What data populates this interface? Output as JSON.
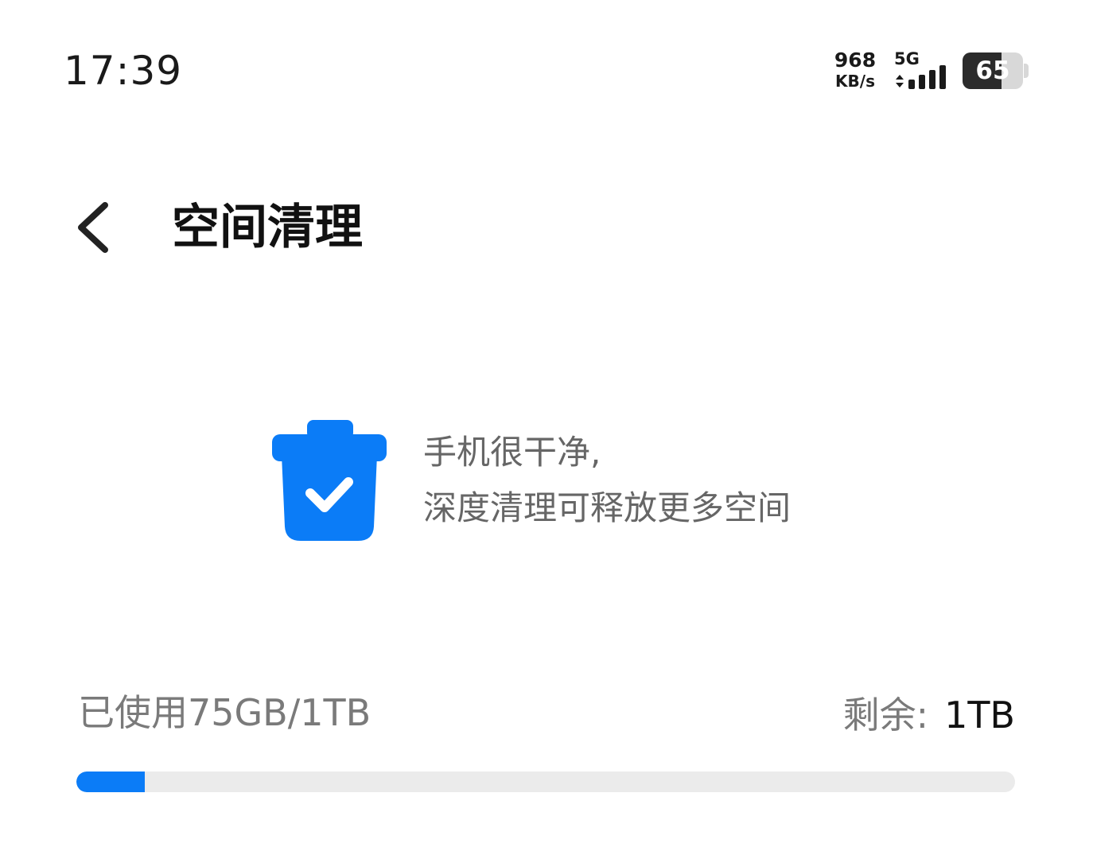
{
  "status_bar": {
    "time": "17:39",
    "net_speed_value": "968",
    "net_speed_unit": "KB/s",
    "network_type": "5G",
    "battery_level": "65"
  },
  "header": {
    "title": "空间清理",
    "back_icon": "chevron-left-icon"
  },
  "clean_status": {
    "icon": "trash-check-icon",
    "line1": "手机很干净,",
    "line2": "深度清理可释放更多空间"
  },
  "storage": {
    "used_text": "已使用75GB/1TB",
    "remaining_label": "剩余:",
    "remaining_value": "1TB",
    "used_fraction": 0.073
  },
  "colors": {
    "accent": "#0b7cf7",
    "track": "#ebebeb",
    "secondary_text": "#666666"
  }
}
